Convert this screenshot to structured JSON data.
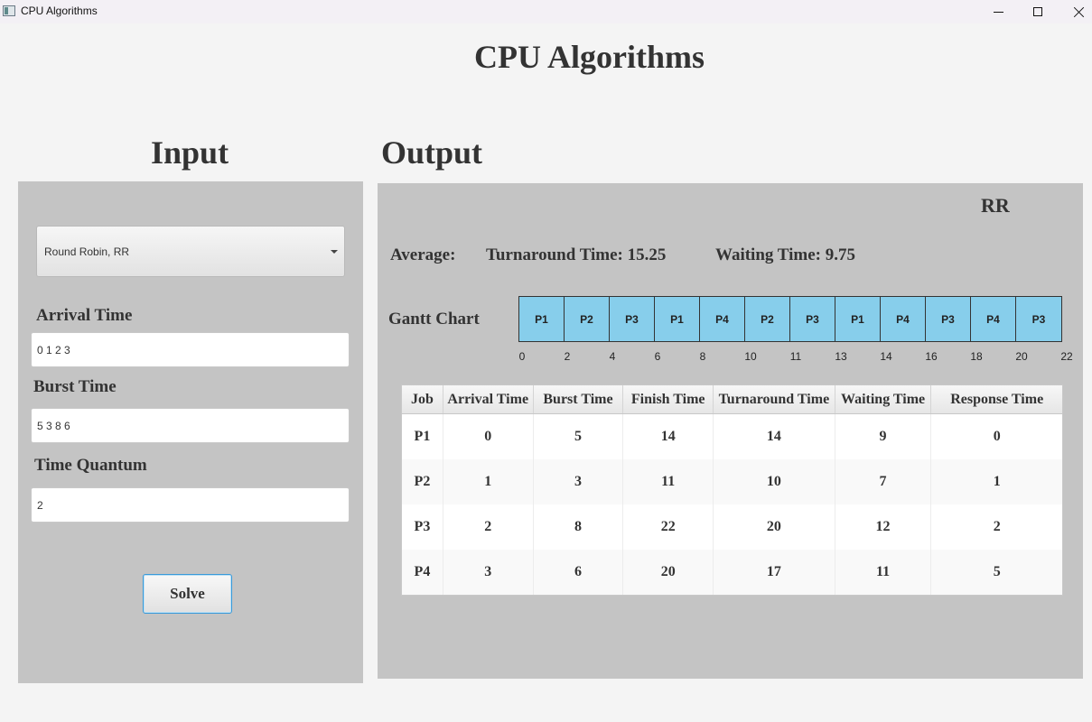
{
  "window": {
    "title": "CPU Algorithms"
  },
  "header": {
    "title": "CPU Algorithms"
  },
  "input": {
    "title": "Input",
    "algorithm": {
      "selected": "Round Robin, RR"
    },
    "arrival_label": "Arrival Time",
    "arrival_value": "0 1 2 3",
    "burst_label": "Burst Time",
    "burst_value": "5 3 8 6",
    "quantum_label": "Time Quantum",
    "quantum_value": "2",
    "solve_label": "Solve"
  },
  "output": {
    "title": "Output",
    "algorithm": "RR",
    "average_label": "Average:",
    "turnaround": "Turnaround Time: 15.25",
    "waiting": "Waiting Time: 9.75",
    "gantt_label": "Gantt Chart",
    "gantt": {
      "blocks": [
        "P1",
        "P2",
        "P3",
        "P1",
        "P4",
        "P2",
        "P3",
        "P1",
        "P4",
        "P3",
        "P4",
        "P3"
      ],
      "ticks": [
        "0",
        "2",
        "4",
        "6",
        "8",
        "10",
        "11",
        "13",
        "14",
        "16",
        "18",
        "20",
        "22"
      ]
    },
    "table": {
      "columns": [
        "Job",
        "Arrival Time",
        "Burst Time",
        "Finish Time",
        "Turnaround Time",
        "Waiting Time",
        "Response Time"
      ],
      "rows": [
        [
          "P1",
          "0",
          "5",
          "14",
          "14",
          "9",
          "0"
        ],
        [
          "P2",
          "1",
          "3",
          "11",
          "10",
          "7",
          "1"
        ],
        [
          "P3",
          "2",
          "8",
          "22",
          "20",
          "12",
          "2"
        ],
        [
          "P4",
          "3",
          "6",
          "20",
          "17",
          "11",
          "5"
        ]
      ]
    }
  },
  "colors": {
    "gantt_fill": "#87ceeb",
    "panel_bg": "#c4c4c4",
    "button_focus": "#3a9ad9"
  }
}
